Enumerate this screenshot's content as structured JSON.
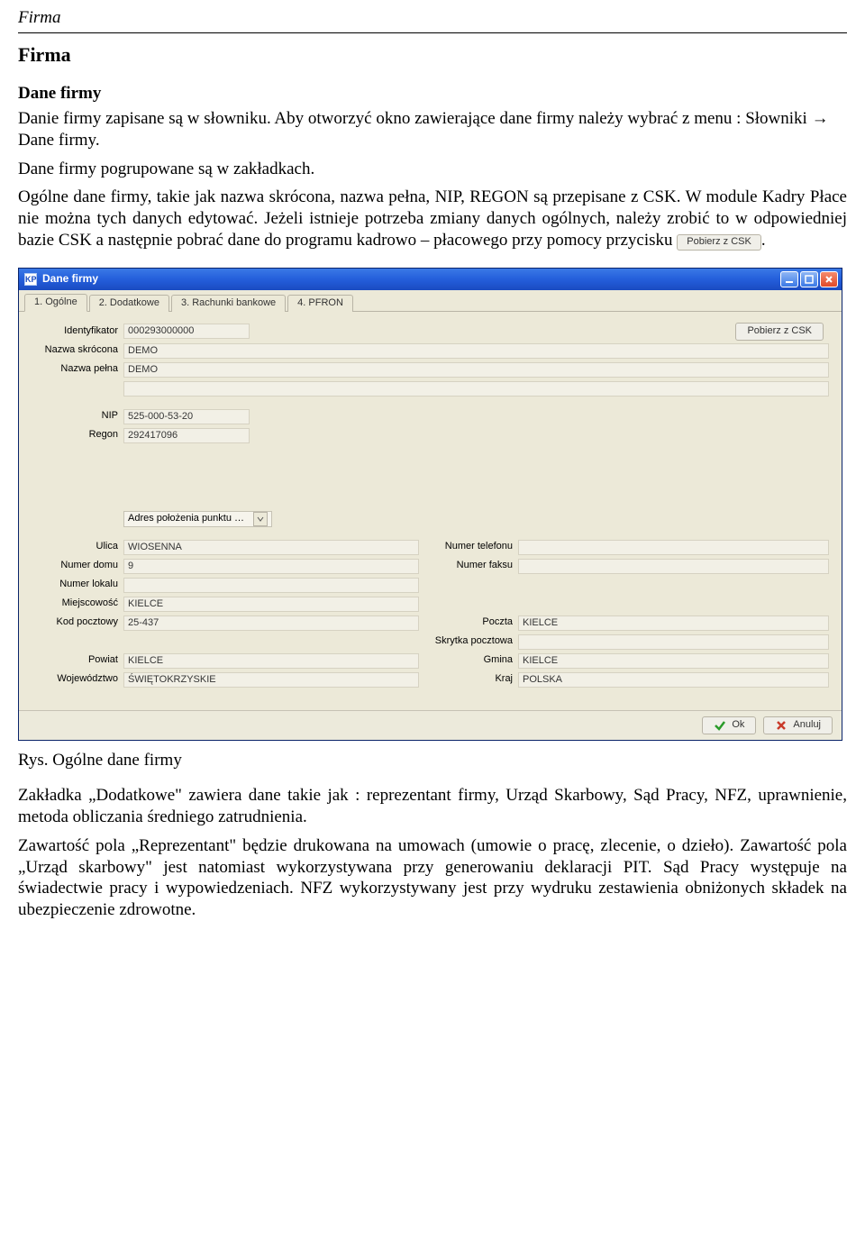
{
  "page_header": "Firma",
  "h1": "Firma",
  "h2": "Dane firmy",
  "para1": "Danie firmy zapisane są w słowniku. Aby otworzyć okno zawierające dane firmy należy wybrać z menu : Słowniki → Dane firmy.",
  "para2": "Dane firmy pogrupowane są w zakładkach.",
  "para3a": "Ogólne dane firmy, takie jak nazwa skrócona, nazwa pełna, NIP, REGON są przepisane z CSK. W module Kadry Płace nie można tych danych edytować.",
  "para3b": "Jeżeli istnieje potrzeba zmiany danych ogólnych, należy zrobić to w odpowiedniej bazie CSK a następnie pobrać dane do programu kadrowo – płacowego przy pomocy przycisku",
  "inline_button": "Pobierz z CSK",
  "caption": "Rys. Ogólne dane firmy",
  "para4": "Zakładka „Dodatkowe\" zawiera dane takie jak : reprezentant firmy, Urząd Skarbowy, Sąd Pracy, NFZ, uprawnienie, metoda obliczania średniego zatrudnienia.",
  "para5": "Zawartość pola „Reprezentant\" będzie drukowana na umowach (umowie o pracę, zlecenie, o dzieło). Zawartość pola „Urząd skarbowy\" jest natomiast wykorzystywana przy generowaniu deklaracji PIT. Sąd Pracy występuje na świadectwie pracy i wypowiedzeniach. NFZ wykorzystywany jest przy wydruku zestawienia obniżonych składek na ubezpieczenie zdrowotne.",
  "window": {
    "title": "Dane firmy",
    "app_icon_text": "KP",
    "tabs": [
      "1. Ogólne",
      "2. Dodatkowe",
      "3. Rachunki bankowe",
      "4. PFRON"
    ],
    "pobierz_btn": "Pobierz z CSK",
    "labels": {
      "identyfikator": "Identyfikator",
      "nazwa_skrocona": "Nazwa skrócona",
      "nazwa_pelna": "Nazwa pełna",
      "nip": "NIP",
      "regon": "Regon",
      "adres_dd": "Adres położenia punktu …",
      "ulica": "Ulica",
      "numer_domu": "Numer domu",
      "numer_lokalu": "Numer lokalu",
      "miejscowosc": "Miejscowość",
      "kod_pocztowy": "Kod pocztowy",
      "powiat": "Powiat",
      "wojewodztwo": "Województwo",
      "numer_telefonu": "Numer telefonu",
      "numer_faksu": "Numer faksu",
      "poczta": "Poczta",
      "skrytka": "Skrytka pocztowa",
      "gmina": "Gmina",
      "kraj": "Kraj"
    },
    "values": {
      "identyfikator": "000293000000",
      "nazwa_skrocona": "DEMO",
      "nazwa_pelna": "DEMO",
      "nazwa_pelna2": "",
      "nip": "525-000-53-20",
      "regon": "292417096",
      "ulica": "WIOSENNA",
      "numer_domu": "9",
      "numer_lokalu": "",
      "miejscowosc": "KIELCE",
      "kod_pocztowy": "25-437",
      "powiat": "KIELCE",
      "wojewodztwo": "ŚWIĘTOKRZYSKIE",
      "numer_telefonu": "",
      "numer_faksu": "",
      "poczta": "KIELCE",
      "skrytka": "",
      "gmina": "KIELCE",
      "kraj": "POLSKA"
    },
    "footer": {
      "ok": "Ok",
      "anuluj": "Anuluj"
    }
  }
}
